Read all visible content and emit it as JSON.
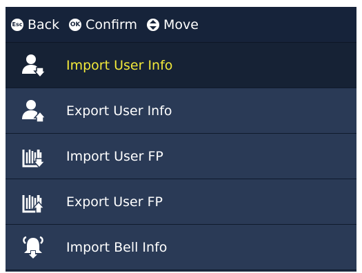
{
  "hints": [
    {
      "key": "Esc",
      "label": "Back"
    },
    {
      "key": "OK",
      "label": "Confirm"
    },
    {
      "key": "updown",
      "label": "Move"
    }
  ],
  "menu": {
    "selected_index": 0,
    "items": [
      {
        "label": "Import User Info",
        "icon": "user-import-icon"
      },
      {
        "label": "Export User Info",
        "icon": "user-export-icon"
      },
      {
        "label": "Import User FP",
        "icon": "fingerprint-import-icon"
      },
      {
        "label": "Export User FP",
        "icon": "fingerprint-export-icon"
      },
      {
        "label": "Import Bell Info",
        "icon": "bell-import-icon"
      }
    ]
  },
  "colors": {
    "background": "#1f2c42",
    "topbar": "#16233a",
    "item": "#2a3a56",
    "selected_item": "#162235",
    "selected_text": "#f2e93a",
    "text": "#ffffff"
  }
}
